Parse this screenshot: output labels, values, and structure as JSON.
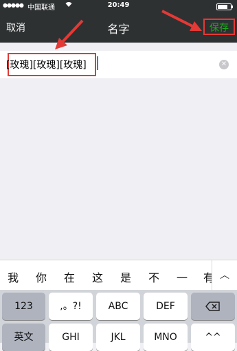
{
  "status_bar": {
    "signal": "●●●●●",
    "carrier": "中国联通",
    "time": "20:49"
  },
  "nav": {
    "cancel": "取消",
    "title": "名字",
    "save": "保存"
  },
  "input": {
    "value": "[玫瑰][玫瑰][玫瑰]"
  },
  "candidates": [
    "我",
    "你",
    "在",
    "这",
    "是",
    "不",
    "一",
    "有"
  ],
  "keyboard": {
    "row1": [
      "123",
      ",。?!",
      "ABC",
      "DEF"
    ],
    "row2": [
      "英文",
      "GHI",
      "JKL",
      "MNO",
      "^^"
    ],
    "more_icon": "chevron-up-icon",
    "delete_icon": "backspace-icon"
  },
  "colors": {
    "bar_bg": "#2e3132",
    "save_green": "#1aad19",
    "highlight_red": "#e53935"
  }
}
